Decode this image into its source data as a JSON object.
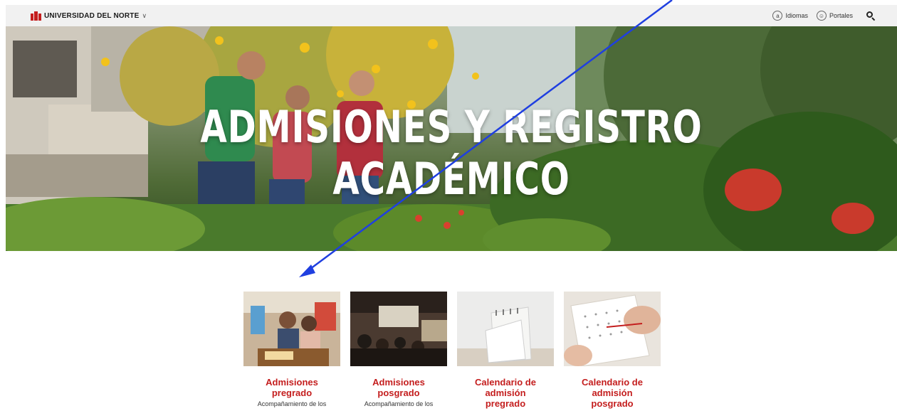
{
  "header": {
    "brand_name": "UNIVERSIDAD DEL NORTE",
    "brand_color": "#c41e1e",
    "links": [
      {
        "label": "Idiomas",
        "icon": "a-circle-icon",
        "glyph": "a"
      },
      {
        "label": "Portales",
        "icon": "user-circle-icon",
        "glyph": "☺"
      }
    ]
  },
  "hero": {
    "title": "ADMISIONES Y REGISTRO ACADÉMICO"
  },
  "cards": [
    {
      "title_line1": "Admisiones",
      "title_line2": "pregrado",
      "title_line3": "",
      "desc": "Acompañamiento de los"
    },
    {
      "title_line1": "Admisiones",
      "title_line2": "posgrado",
      "title_line3": "",
      "desc": "Acompañamiento de los"
    },
    {
      "title_line1": "Calendario de",
      "title_line2": "admisión",
      "title_line3": "pregrado",
      "desc": ""
    },
    {
      "title_line1": "Calendario de",
      "title_line2": "admisión",
      "title_line3": "posgrado",
      "desc": ""
    }
  ],
  "colors": {
    "accent": "#c41e1e",
    "annotation_arrow": "#1f3fe0"
  }
}
